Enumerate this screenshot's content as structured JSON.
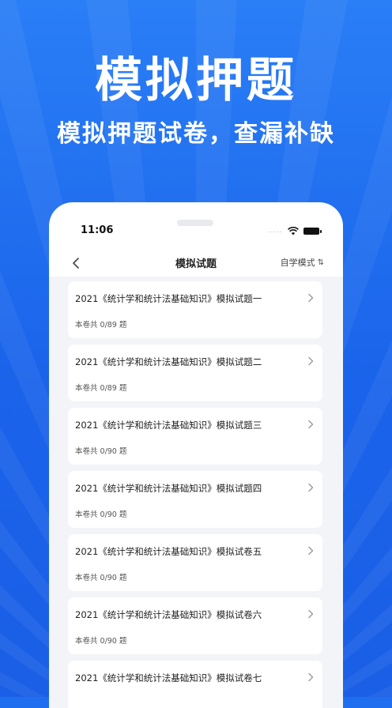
{
  "hero": {
    "title": "模拟押题",
    "subtitle": "模拟押题试卷，查漏补缺"
  },
  "status_bar": {
    "time": "11:06",
    "signal": "....."
  },
  "navbar": {
    "title": "模拟试题",
    "mode_label": "自学模式",
    "sort_glyph": "⇅"
  },
  "papers": [
    {
      "title": "2021《统计学和统计法基础知识》模拟试题一",
      "count": "本卷共 0/89 题"
    },
    {
      "title": "2021《统计学和统计法基础知识》模拟试题二",
      "count": "本卷共 0/89 题"
    },
    {
      "title": "2021《统计学和统计法基础知识》模拟试题三",
      "count": "本卷共 0/90 题"
    },
    {
      "title": "2021《统计学和统计法基础知识》模拟试题四",
      "count": "本卷共 0/90 题"
    },
    {
      "title": "2021《统计学和统计法基础知识》模拟试卷五",
      "count": "本卷共 0/90 题"
    },
    {
      "title": "2021《统计学和统计法基础知识》模拟试卷六",
      "count": "本卷共 0/90 题"
    },
    {
      "title": "2021《统计学和统计法基础知识》模拟试卷七",
      "count": ""
    }
  ],
  "colors": {
    "brand_blue": "#1f6ef0",
    "list_background": "#f3f4f7",
    "card_background": "#ffffff"
  }
}
